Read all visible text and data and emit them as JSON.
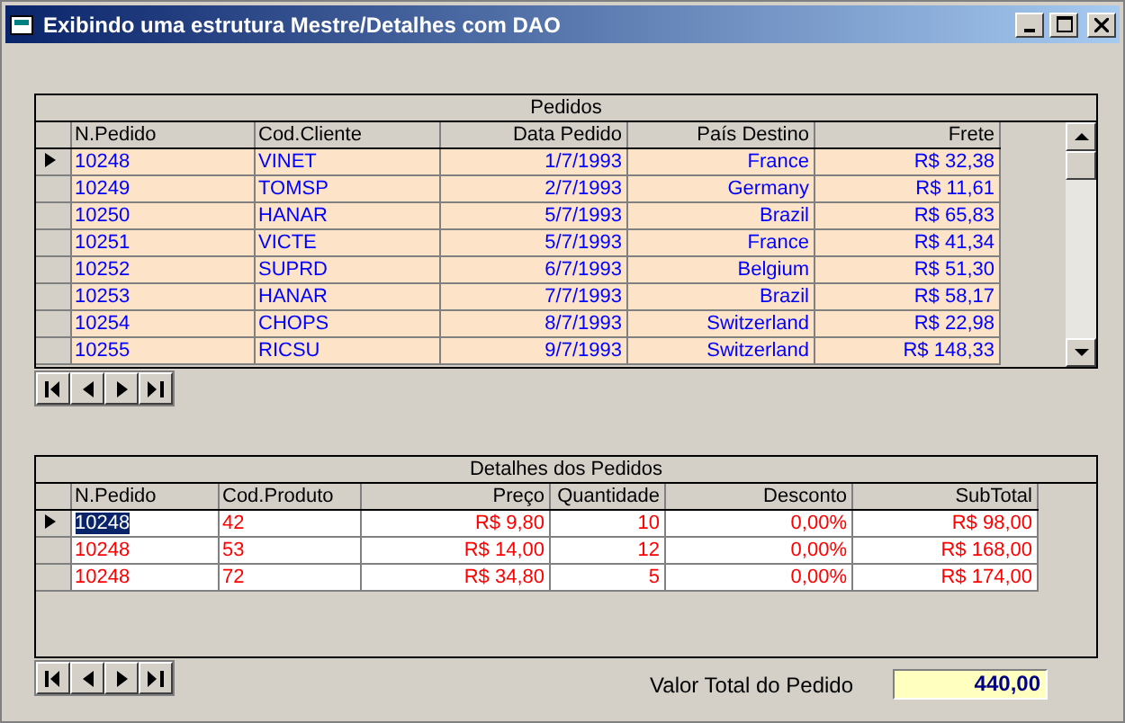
{
  "window": {
    "title": "Exibindo uma estrutura Mestre/Detalhes com DAO"
  },
  "orders": {
    "caption": "Pedidos",
    "columns": [
      {
        "label": "N.Pedido"
      },
      {
        "label": "Cod.Cliente"
      },
      {
        "label": "Data Pedido"
      },
      {
        "label": "País Destino"
      },
      {
        "label": "Frete"
      }
    ],
    "rows": [
      {
        "selected": true,
        "cells": [
          "10248",
          "VINET",
          "1/7/1993",
          "France",
          "R$ 32,38"
        ]
      },
      {
        "selected": false,
        "cells": [
          "10249",
          "TOMSP",
          "2/7/1993",
          "Germany",
          "R$ 11,61"
        ]
      },
      {
        "selected": false,
        "cells": [
          "10250",
          "HANAR",
          "5/7/1993",
          "Brazil",
          "R$ 65,83"
        ]
      },
      {
        "selected": false,
        "cells": [
          "10251",
          "VICTE",
          "5/7/1993",
          "France",
          "R$ 41,34"
        ]
      },
      {
        "selected": false,
        "cells": [
          "10252",
          "SUPRD",
          "6/7/1993",
          "Belgium",
          "R$ 51,30"
        ]
      },
      {
        "selected": false,
        "cells": [
          "10253",
          "HANAR",
          "7/7/1993",
          "Brazil",
          "R$ 58,17"
        ]
      },
      {
        "selected": false,
        "cells": [
          "10254",
          "CHOPS",
          "8/7/1993",
          "Switzerland",
          "R$ 22,98"
        ]
      },
      {
        "selected": false,
        "cells": [
          "10255",
          "RICSU",
          "9/7/1993",
          "Switzerland",
          "R$ 148,33"
        ]
      }
    ]
  },
  "details": {
    "caption": "Detalhes dos Pedidos",
    "columns": [
      {
        "label": "N.Pedido"
      },
      {
        "label": "Cod.Produto"
      },
      {
        "label": "Preço"
      },
      {
        "label": "Quantidade"
      },
      {
        "label": "Desconto"
      },
      {
        "label": "SubTotal"
      }
    ],
    "rows": [
      {
        "selected": true,
        "cells": [
          {
            "text": "10248",
            "focused": true
          },
          {
            "text": "42",
            "focused": false
          },
          {
            "text": "R$ 9,80",
            "focused": false
          },
          {
            "text": "10",
            "focused": false
          },
          {
            "text": "0,00%",
            "focused": false
          },
          {
            "text": "R$ 98,00",
            "focused": false
          }
        ]
      },
      {
        "selected": false,
        "cells": [
          {
            "text": "10248",
            "focused": false
          },
          {
            "text": "53",
            "focused": false
          },
          {
            "text": "R$ 14,00",
            "focused": false
          },
          {
            "text": "12",
            "focused": false
          },
          {
            "text": "0,00%",
            "focused": false
          },
          {
            "text": "R$ 168,00",
            "focused": false
          }
        ]
      },
      {
        "selected": false,
        "cells": [
          {
            "text": "10248",
            "focused": false
          },
          {
            "text": "72",
            "focused": false
          },
          {
            "text": "R$ 34,80",
            "focused": false
          },
          {
            "text": "5",
            "focused": false
          },
          {
            "text": "0,00%",
            "focused": false
          },
          {
            "text": "R$ 174,00",
            "focused": false
          }
        ]
      }
    ]
  },
  "total": {
    "label": "Valor Total do Pedido",
    "value": "440,00"
  }
}
